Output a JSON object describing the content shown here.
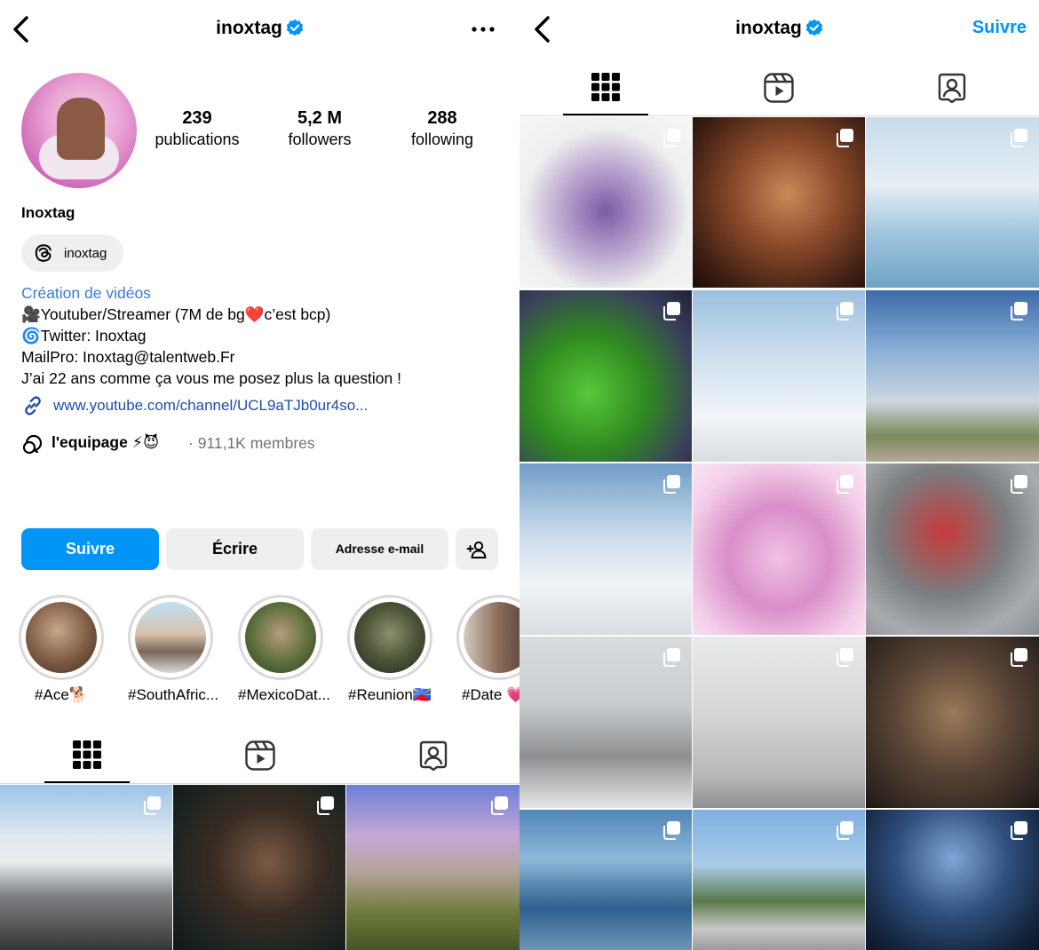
{
  "left": {
    "header": {
      "username": "inoxtag"
    },
    "stats": [
      {
        "value": "239",
        "label": "publications"
      },
      {
        "value": "5,2 M",
        "label": "followers"
      },
      {
        "value": "288",
        "label": "following"
      }
    ],
    "display_name": "Inoxtag",
    "threads_handle": "inoxtag",
    "bio": {
      "category": "Création de vidéos",
      "lines": [
        "🎥Youtuber/Streamer (7M de bg❤️c’est bcp)",
        "🌀Twitter: Inoxtag",
        "MailPro: Inoxtag@talentweb.Fr",
        "J’ai 22 ans comme ça vous me posez plus la question !"
      ]
    },
    "link": "www.youtube.com/channel/UCL9aTJb0ur4so...",
    "channel": {
      "name": "l'equipage ⚡😈",
      "members": "· 911,1K membres"
    },
    "buttons": {
      "follow": "Suivre",
      "message": "Écrire",
      "email": "Adresse e-mail"
    },
    "highlights": [
      "#Ace🐕",
      "#SouthAfric...",
      "#MexicoDat...",
      "#Reunion🇷🇪",
      "#Date 💗"
    ]
  },
  "right": {
    "header": {
      "username": "inoxtag",
      "follow": "Suivre"
    }
  },
  "colors": {
    "accent": "#0095f6",
    "verified": "#0095f6",
    "link": "#1f4ea8"
  },
  "icons": [
    "back-chevron-icon",
    "verified-badge-icon",
    "more-dots-icon",
    "threads-icon",
    "link-icon",
    "channel-icon",
    "add-user-icon",
    "grid-icon",
    "reels-icon",
    "tagged-icon",
    "multi-post-icon"
  ]
}
